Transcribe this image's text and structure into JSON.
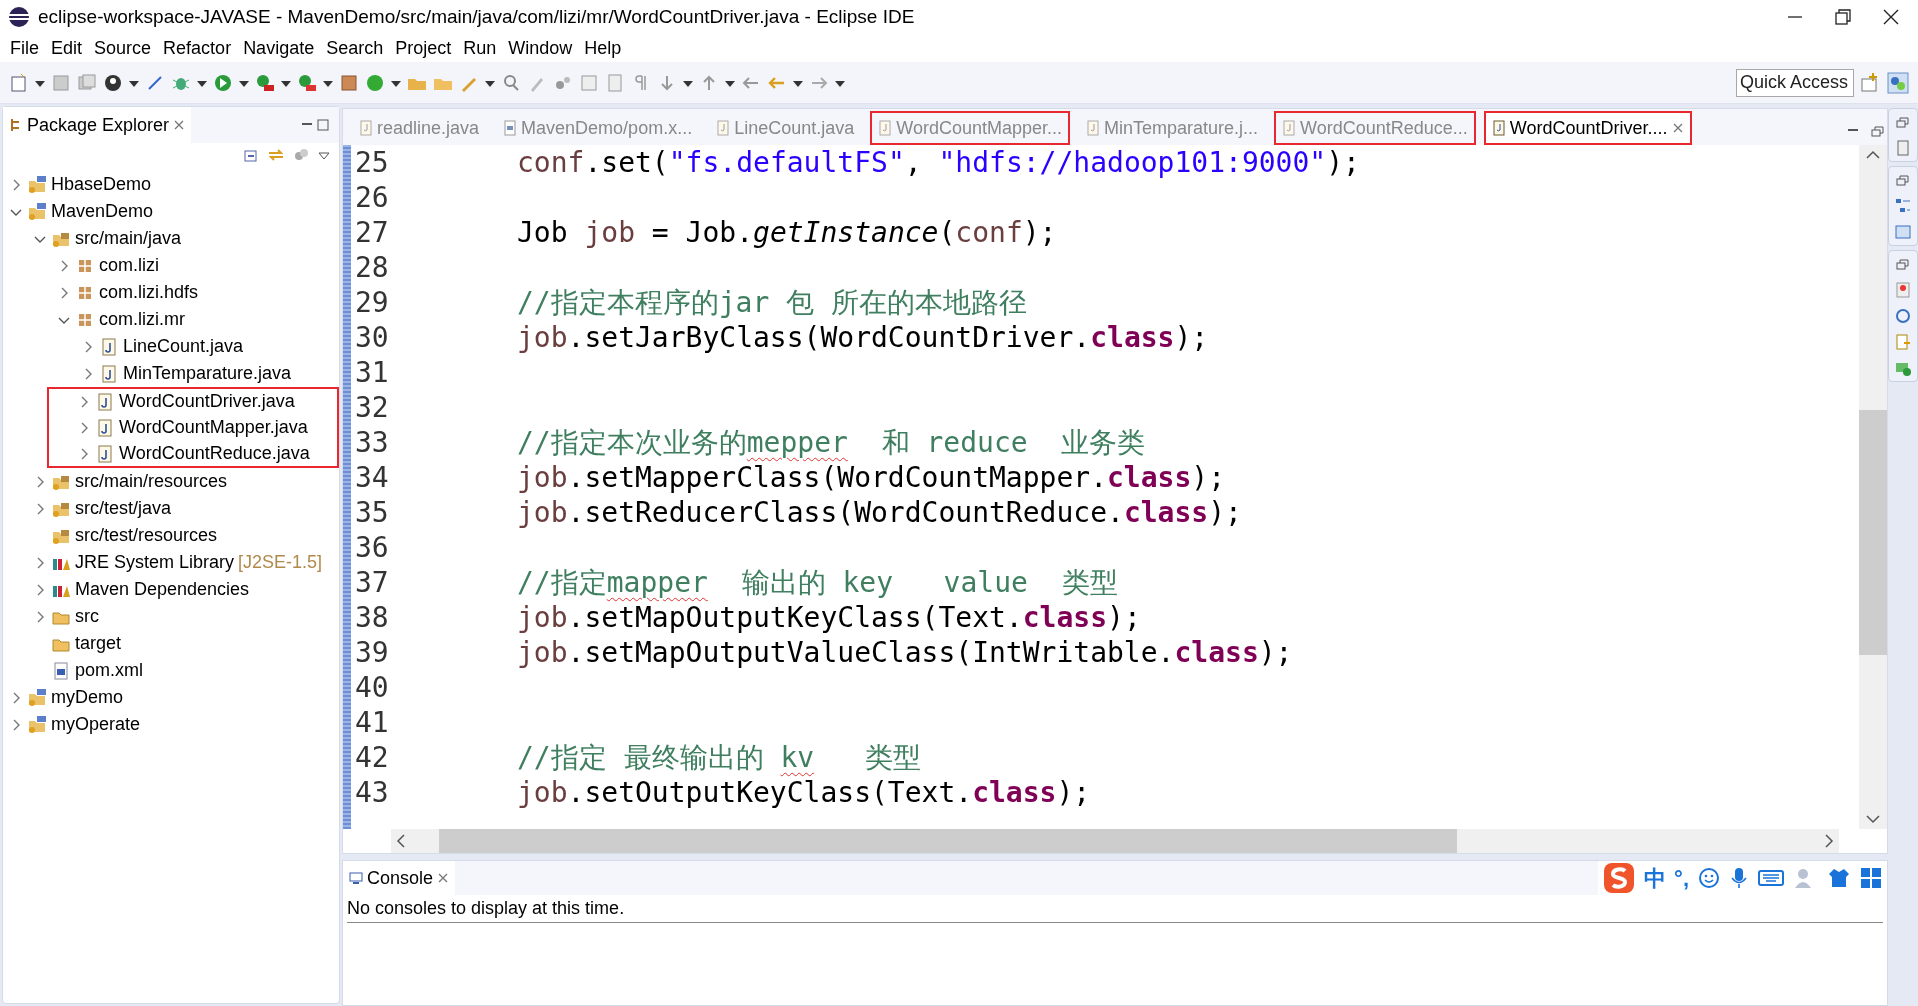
{
  "window": {
    "title": "eclipse-workspace-JAVASE - MavenDemo/src/main/java/com/lizi/mr/WordCountDriver.java - Eclipse IDE"
  },
  "menu": [
    "File",
    "Edit",
    "Source",
    "Refactor",
    "Navigate",
    "Search",
    "Project",
    "Run",
    "Window",
    "Help"
  ],
  "quick_access": {
    "placeholder": "Quick Access"
  },
  "package_explorer": {
    "title": "Package Explorer",
    "tree": [
      {
        "name": "HbaseDemo",
        "kind": "project",
        "expandable": true,
        "expanded": false,
        "highlighted": false
      },
      {
        "name": "MavenDemo",
        "kind": "project",
        "expandable": true,
        "expanded": true,
        "highlighted": false,
        "children": [
          {
            "name": "src/main/java",
            "kind": "source-folder",
            "expandable": true,
            "expanded": true,
            "highlighted": false,
            "children": [
              {
                "name": "com.lizi",
                "kind": "package",
                "expandable": true,
                "expanded": false,
                "highlighted": false
              },
              {
                "name": "com.lizi.hdfs",
                "kind": "package",
                "expandable": true,
                "expanded": false,
                "highlighted": false
              },
              {
                "name": "com.lizi.mr",
                "kind": "package",
                "expandable": true,
                "expanded": true,
                "highlighted": false,
                "children": [
                  {
                    "name": "LineCount.java",
                    "kind": "java",
                    "expandable": true,
                    "expanded": false,
                    "highlighted": false
                  },
                  {
                    "name": "MinTemparature.java",
                    "kind": "java",
                    "expandable": true,
                    "expanded": false,
                    "highlighted": false
                  },
                  {
                    "name": "WordCountDriver.java",
                    "kind": "java",
                    "expandable": true,
                    "expanded": false,
                    "highlighted": true
                  },
                  {
                    "name": "WordCountMapper.java",
                    "kind": "java",
                    "expandable": true,
                    "expanded": false,
                    "highlighted": true
                  },
                  {
                    "name": "WordCountReduce.java",
                    "kind": "java",
                    "expandable": true,
                    "expanded": false,
                    "highlighted": true
                  }
                ]
              }
            ]
          },
          {
            "name": "src/main/resources",
            "kind": "source-folder",
            "expandable": true,
            "expanded": false,
            "highlighted": false
          },
          {
            "name": "src/test/java",
            "kind": "source-folder",
            "expandable": true,
            "expanded": false,
            "highlighted": false
          },
          {
            "name": "src/test/resources",
            "kind": "source-folder",
            "expandable": false,
            "highlighted": false
          },
          {
            "name": "JRE System Library",
            "suffix": "[J2SE-1.5]",
            "kind": "library",
            "expandable": true,
            "expanded": false,
            "highlighted": false
          },
          {
            "name": "Maven Dependencies",
            "kind": "library",
            "expandable": true,
            "expanded": false,
            "highlighted": false
          },
          {
            "name": "src",
            "kind": "folder",
            "expandable": true,
            "expanded": false,
            "highlighted": false
          },
          {
            "name": "target",
            "kind": "folder",
            "expandable": false,
            "highlighted": false
          },
          {
            "name": "pom.xml",
            "kind": "xml",
            "expandable": false,
            "highlighted": false
          }
        ]
      },
      {
        "name": "myDemo",
        "kind": "project",
        "expandable": true,
        "expanded": false,
        "highlighted": false
      },
      {
        "name": "myOperate",
        "kind": "project",
        "expandable": true,
        "expanded": false,
        "highlighted": false
      }
    ]
  },
  "editor_tabs": [
    {
      "label": "readline.java",
      "kind": "java",
      "selected": false,
      "highlighted": false
    },
    {
      "label": "MavenDemo/pom.x...",
      "kind": "xml",
      "selected": false,
      "highlighted": false
    },
    {
      "label": "LineCount.java",
      "kind": "java",
      "selected": false,
      "highlighted": false
    },
    {
      "label": "WordCountMapper...",
      "kind": "java",
      "selected": false,
      "highlighted": true
    },
    {
      "label": "MinTemparature.j...",
      "kind": "java",
      "selected": false,
      "highlighted": false
    },
    {
      "label": "WordCountReduce...",
      "kind": "java",
      "selected": false,
      "highlighted": true
    },
    {
      "label": "WordCountDriver....",
      "kind": "java",
      "selected": true,
      "highlighted": true
    }
  ],
  "code_lines": [
    {
      "number": "25",
      "tokens": [
        {
          "text": "conf",
          "kind": "variable"
        },
        {
          "text": ".set(",
          "kind": "plain"
        },
        {
          "text": "\"fs.defaultFS\"",
          "kind": "string"
        },
        {
          "text": ", ",
          "kind": "plain"
        },
        {
          "text": "\"hdfs://hadoop101:9000\"",
          "kind": "string"
        },
        {
          "text": ");",
          "kind": "plain"
        }
      ]
    },
    {
      "number": "26"
    },
    {
      "number": "27",
      "tokens": [
        {
          "text": "Job ",
          "kind": "plain"
        },
        {
          "text": "job",
          "kind": "variable"
        },
        {
          "text": " = Job.",
          "kind": "plain"
        },
        {
          "text": "getInstance",
          "kind": "static"
        },
        {
          "text": "(",
          "kind": "plain"
        },
        {
          "text": "conf",
          "kind": "variable"
        },
        {
          "text": ");",
          "kind": "plain"
        }
      ]
    },
    {
      "number": "28"
    },
    {
      "number": "29",
      "tokens": [
        {
          "text": "//指定本程序的jar 包 所在的本地路径",
          "kind": "comment"
        }
      ]
    },
    {
      "number": "30",
      "tokens": [
        {
          "text": "job",
          "kind": "variable"
        },
        {
          "text": ".setJarByClass(WordCountDriver.",
          "kind": "plain"
        },
        {
          "text": "class",
          "kind": "keyword"
        },
        {
          "text": ");",
          "kind": "plain"
        }
      ]
    },
    {
      "number": "31"
    },
    {
      "number": "32"
    },
    {
      "number": "33",
      "tokens": [
        {
          "text": "//指定本次业务的",
          "kind": "comment"
        },
        {
          "text": "mepper",
          "kind": "comment",
          "misspelled": true
        },
        {
          "text": "  和 reduce  业务类",
          "kind": "comment"
        }
      ]
    },
    {
      "number": "34",
      "tokens": [
        {
          "text": "job",
          "kind": "variable"
        },
        {
          "text": ".setMapperClass(WordCountMapper.",
          "kind": "plain"
        },
        {
          "text": "class",
          "kind": "keyword"
        },
        {
          "text": ");",
          "kind": "plain"
        }
      ]
    },
    {
      "number": "35",
      "tokens": [
        {
          "text": "job",
          "kind": "variable"
        },
        {
          "text": ".setReducerClass(WordCountReduce.",
          "kind": "plain"
        },
        {
          "text": "class",
          "kind": "keyword"
        },
        {
          "text": ");",
          "kind": "plain"
        }
      ]
    },
    {
      "number": "36"
    },
    {
      "number": "37",
      "tokens": [
        {
          "text": "//指定",
          "kind": "comment"
        },
        {
          "text": "mapper",
          "kind": "comment",
          "misspelled": true
        },
        {
          "text": "  输出的 key   value  类型",
          "kind": "comment"
        }
      ]
    },
    {
      "number": "38",
      "tokens": [
        {
          "text": "job",
          "kind": "variable"
        },
        {
          "text": ".setMapOutputKeyClass(Text.",
          "kind": "plain"
        },
        {
          "text": "class",
          "kind": "keyword"
        },
        {
          "text": ");",
          "kind": "plain"
        }
      ]
    },
    {
      "number": "39",
      "tokens": [
        {
          "text": "job",
          "kind": "variable"
        },
        {
          "text": ".setMapOutputValueClass(IntWritable.",
          "kind": "plain"
        },
        {
          "text": "class",
          "kind": "keyword"
        },
        {
          "text": ");",
          "kind": "plain"
        }
      ]
    },
    {
      "number": "40"
    },
    {
      "number": "41"
    },
    {
      "number": "42",
      "tokens": [
        {
          "text": "//指定 最终输出的 ",
          "kind": "comment"
        },
        {
          "text": "kv",
          "kind": "comment",
          "misspelled": true
        },
        {
          "text": "   类型",
          "kind": "comment"
        }
      ]
    },
    {
      "number": "43",
      "tokens": [
        {
          "text": "job",
          "kind": "variable"
        },
        {
          "text": ".setOutputKeyClass(Text.",
          "kind": "plain"
        },
        {
          "text": "class",
          "kind": "keyword"
        },
        {
          "text": ");",
          "kind": "plain"
        }
      ]
    }
  ],
  "console": {
    "title": "Console",
    "message": "No consoles to display at this time."
  },
  "ime_bar": {
    "mode": "中",
    "punctuation": "°,"
  }
}
